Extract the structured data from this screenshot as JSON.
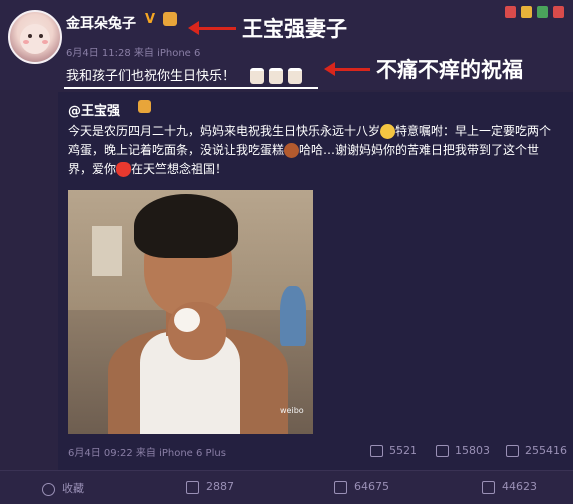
{
  "post": {
    "author": "金耳朵兔子",
    "verified_badge": "V",
    "meta": "6月4日 11:28 来自 iPhone 6",
    "text": "我和孩子们也祝你生日快乐！"
  },
  "annotations": {
    "top": "王宝强妻子",
    "middle": "不痛不痒的祝福"
  },
  "repost": {
    "author": "@王宝强",
    "line1": "今天是农历四月二十九，妈妈来电祝我生日快乐永远十八岁",
    "line1b": "特意嘱咐：早上一定要吃两个",
    "line2": "鸡蛋，晚上记着吃面条，没说让我吃蛋糕",
    "line2b": "哈哈…谢谢妈妈你的苦难日把我带到了这个世",
    "line3": "界，爱你",
    "line3b": "在天竺想念祖国！",
    "watermark": "weibo",
    "meta": "6月4日 09:22 来自 iPhone 6 Plus",
    "stats": {
      "forward": "5521",
      "comment": "15803",
      "like": "255416"
    }
  },
  "bottom_bar": {
    "collect": "收藏",
    "forward": "2887",
    "comment": "64675",
    "like": "44623"
  },
  "colors": {
    "background": "#2b2442",
    "annotation_red": "#d9261c",
    "accent": "#f5a623"
  }
}
